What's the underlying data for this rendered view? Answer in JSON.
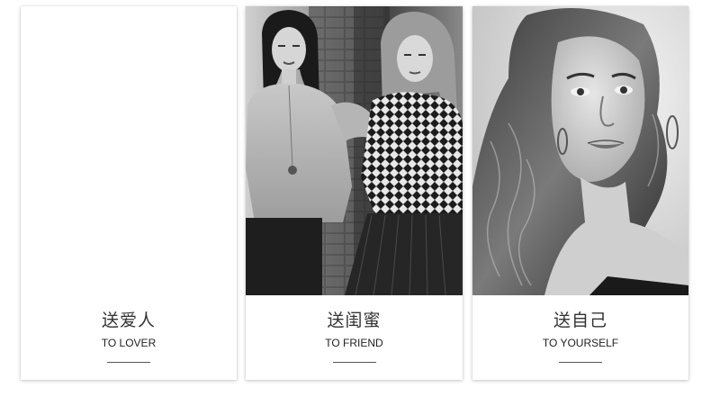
{
  "cards": [
    {
      "title_zh": "送爱人",
      "title_en": "TO LOVER",
      "has_photo": false
    },
    {
      "title_zh": "送闺蜜",
      "title_en": "TO FRIEND",
      "has_photo": true,
      "photo_icon": "two-women-photo"
    },
    {
      "title_zh": "送自己",
      "title_en": "TO YOURSELF",
      "has_photo": true,
      "photo_icon": "woman-portrait-photo"
    }
  ],
  "colors": {
    "card_bg": "#ffffff",
    "text_zh": "#333333",
    "text_en": "#222222",
    "divider": "#555555"
  }
}
